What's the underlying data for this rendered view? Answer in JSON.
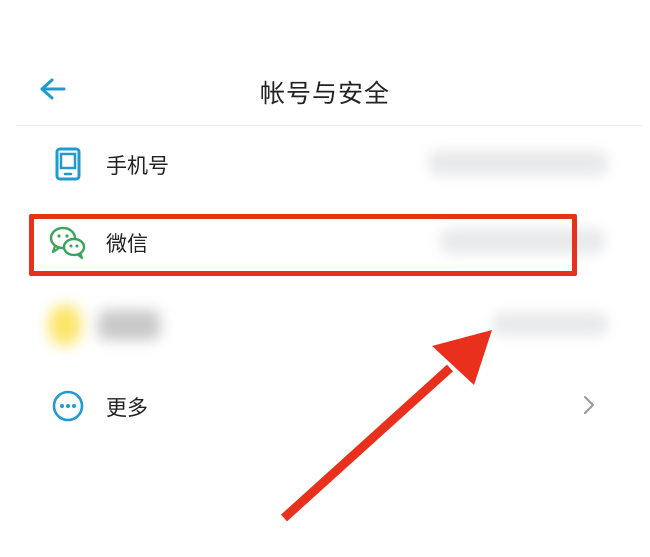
{
  "header": {
    "title": "帐号与安全"
  },
  "rows": {
    "phone": {
      "label": "手机号"
    },
    "wechat": {
      "label": "微信"
    },
    "more": {
      "label": "更多"
    }
  },
  "colors": {
    "accent": "#1f9bd1",
    "wechat_icon": "#3aa55a",
    "highlight": "#e8301c"
  }
}
